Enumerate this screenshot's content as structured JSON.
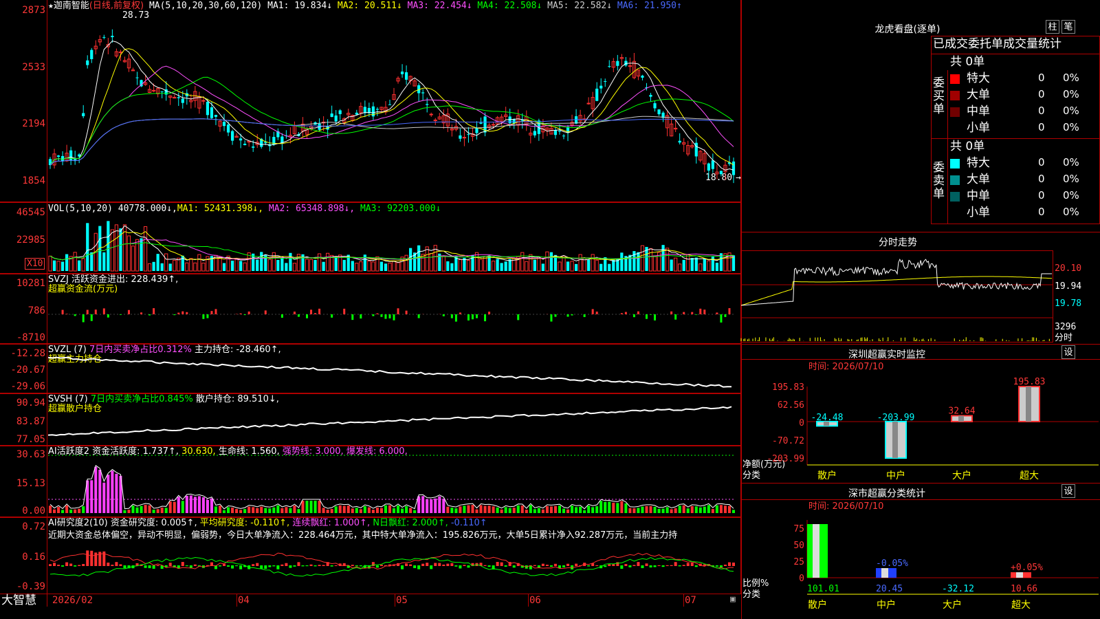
{
  "stock": {
    "star": "★",
    "name": "迦南智能",
    "mode": "(日线,前复权)",
    "ma_head": "MA(5,10,20,30,60,120)"
  },
  "ma_values": [
    {
      "label": "MA1: 19.834↓",
      "color": "#ffffff"
    },
    {
      "label": "MA2: 20.511↓",
      "color": "#ffff00"
    },
    {
      "label": "MA3: 22.454↓",
      "color": "#ff50ff"
    },
    {
      "label": "MA4: 22.508↓",
      "color": "#00ff00"
    },
    {
      "label": "MA5: 22.582↓",
      "color": "#cccccc"
    },
    {
      "label": "MA6: 21.950↑",
      "color": "#4a6aff"
    }
  ],
  "price_axis": [
    "2873",
    "2533",
    "2194",
    "1854"
  ],
  "price_high": "28.73",
  "price_low": "18.80",
  "vol": {
    "head": "VOL(5,10,20)",
    "val": "40778.000↓,",
    "ma1": "MA1: 52431.398↓,",
    "ma2": "MA2: 65348.898↓,",
    "ma3": "MA3: 92203.000↓",
    "axis": [
      "46545",
      "22985"
    ],
    "unit": "X10"
  },
  "svzj": {
    "head": "SVZJ  活跃资金进出: 228.439↑,",
    "sub": "超赢资金流(万元)",
    "axis": [
      "10281",
      "786",
      "-8710"
    ]
  },
  "svzl": {
    "head1": "SVZL (7)",
    "head2": "7日内买卖净占比0.312%",
    "head3": "主力持仓: -28.460↑,",
    "sub": "超赢主力持仓",
    "axis": [
      "-12.28",
      "-20.67",
      "-29.06"
    ]
  },
  "svsh": {
    "head1": "SVSH (7)",
    "head2": "7日内买卖净占比0.845%",
    "head3": "散户持仓: 89.510↓,",
    "sub": "超赢散户持仓",
    "axis": [
      "90.94",
      "83.87",
      "77.05"
    ]
  },
  "ai1": {
    "head1": "AI活跃度2",
    "head2": "资金活跃度: 1.737↑,",
    "head3": "30.630,",
    "head4": "生命线: 1.560,",
    "head5": "强势线: 3.000,",
    "head6": "爆发线: 6.000,",
    "axis": [
      "30.63",
      "15.13",
      "0.00"
    ]
  },
  "ai2": {
    "head1": "AI研究度2(10)",
    "head2": "资金研究度: 0.005↑,",
    "head3": "平均研究度: -0.110↑,",
    "head4": "连续飘红: 1.000↑,",
    "head5": "N日飘红: 2.000↑,",
    "head6": "-0.110↑",
    "text": "近期大资金总体偏空，异动不明显，偏弱势，今日大单净流入：228.464万元，其中特大单净流入：195.826万元，大单5日累计净入92.287万元，当前主力持",
    "axis": [
      "0.72",
      "0.16",
      "-0.39"
    ]
  },
  "date_axis": [
    "2026/02",
    "04",
    "05",
    "06",
    "07"
  ],
  "logo": "大智慧",
  "right": {
    "title": "龙虎看盘(逐单)",
    "btn1": "柱",
    "btn2": "笔",
    "sub": "已成交委托单成交量统计",
    "buy": {
      "side": "委买单",
      "total": "共 0单",
      "rows": [
        {
          "n": "特大",
          "v": "0",
          "p": "0%",
          "c": "#ff0000"
        },
        {
          "n": "大单",
          "v": "0",
          "p": "0%",
          "c": "#a00000"
        },
        {
          "n": "中单",
          "v": "0",
          "p": "0%",
          "c": "#700000"
        },
        {
          "n": "小单",
          "v": "0",
          "p": "0%",
          "c": "#000000"
        }
      ]
    },
    "sell": {
      "side": "委卖单",
      "total": "共 0单",
      "rows": [
        {
          "n": "特大",
          "v": "0",
          "p": "0%",
          "c": "#00ffff"
        },
        {
          "n": "大单",
          "v": "0",
          "p": "0%",
          "c": "#009090"
        },
        {
          "n": "中单",
          "v": "0",
          "p": "0%",
          "c": "#006060"
        },
        {
          "n": "小单",
          "v": "0",
          "p": "0%",
          "c": "#000000"
        }
      ]
    },
    "fenshi": {
      "title": "分时走势",
      "axis": [
        "20.10",
        "19.94",
        "19.78"
      ],
      "vol": "3296",
      "unit": "分时"
    },
    "monitor": {
      "title": "深圳超赢实时监控",
      "btn": "设",
      "time": "时间: 2026/07/10",
      "axis": [
        "195.83",
        "62.56",
        "0",
        "-70.72",
        "-203.99"
      ],
      "ylab": "净额(万元)",
      "xlab": "分类"
    },
    "classify": {
      "title": "深市超赢分类统计",
      "btn": "设",
      "time": "时间: 2026/07/10",
      "axis": [
        "75",
        "50",
        "25",
        "0"
      ],
      "ylab": "比例%",
      "xlab": "分类"
    }
  },
  "chart_data": [
    {
      "type": "bar",
      "title": "深圳超赢实时监控",
      "categories": [
        "散户",
        "中户",
        "大户",
        "超大"
      ],
      "values": [
        -24.48,
        -203.99,
        32.64,
        195.83
      ],
      "ylim": [
        -203.99,
        195.83
      ],
      "ylabel": "净额(万元)",
      "xlabel": "分类"
    },
    {
      "type": "bar",
      "title": "深市超赢分类统计",
      "categories": [
        "散户",
        "中户",
        "大户",
        "超大"
      ],
      "values": [
        101.01,
        20.45,
        -32.12,
        10.66
      ],
      "bar_labels": [
        "",
        "-0.05%",
        "",
        "+0.05%"
      ],
      "ylabel": "比例%",
      "xlabel": "分类"
    }
  ]
}
